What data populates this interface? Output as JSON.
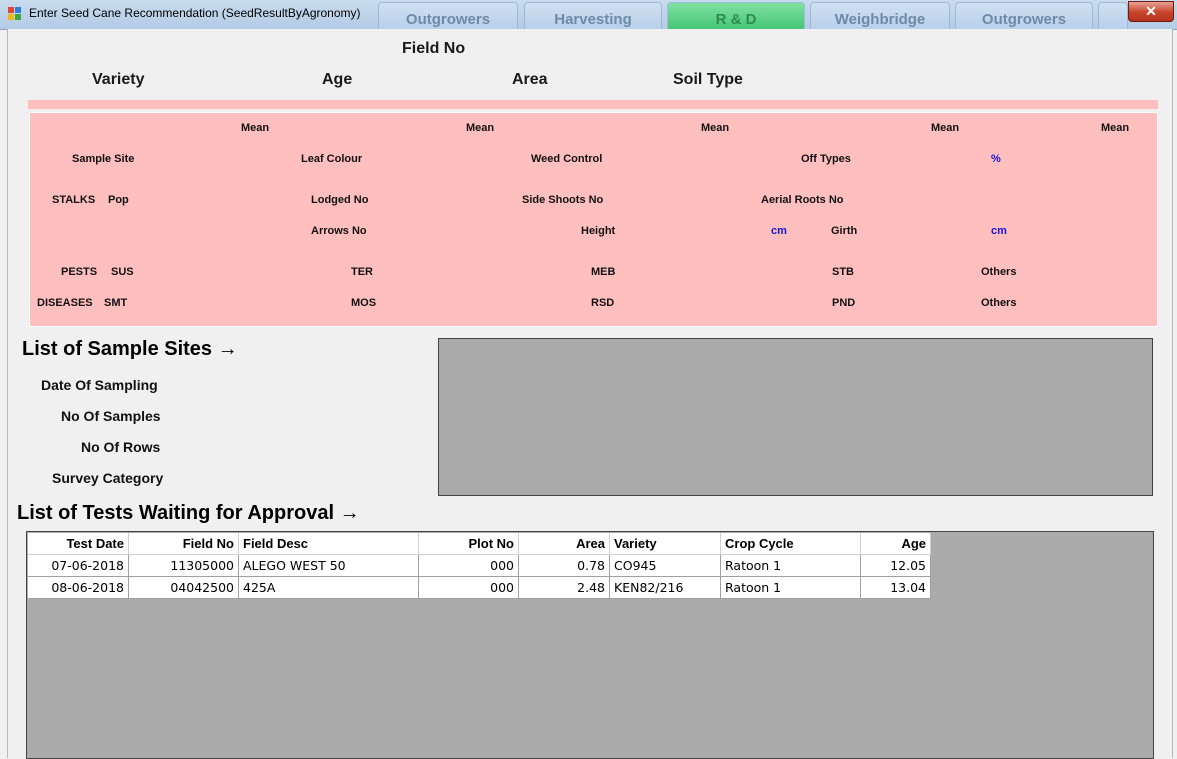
{
  "window": {
    "title": "Enter Seed Cane Recommendation (SeedResultByAgronomy)",
    "background_tabs": [
      "Outgrowers",
      "Harvesting",
      "R & D",
      "Weighbridge",
      "Outgrowers"
    ],
    "close_label": "✕"
  },
  "header": {
    "field_no": "Field No",
    "variety": "Variety",
    "age": "Age",
    "area": "Area",
    "soil_type": "Soil Type"
  },
  "panel": {
    "mean": "Mean",
    "sample_site": "Sample Site",
    "leaf_colour": "Leaf Colour",
    "weed_control": "Weed Control",
    "off_types": "Off Types",
    "percent": "%",
    "stalks": "STALKS",
    "pop": "Pop",
    "lodged_no": "Lodged No",
    "side_shoots_no": "Side Shoots No",
    "aerial_roots_no": "Aerial Roots No",
    "arrows_no": "Arrows No",
    "height": "Height",
    "cm": "cm",
    "girth": "Girth",
    "pests": "PESTS",
    "sus": "SUS",
    "ter": "TER",
    "meb": "MEB",
    "stb": "STB",
    "others": "Others",
    "diseases": "DISEASES",
    "smt": "SMT",
    "mos": "MOS",
    "rsd": "RSD",
    "pnd": "PND"
  },
  "sample_sites": {
    "title": "List of Sample Sites →",
    "date_of_sampling": "Date Of Sampling",
    "no_of_samples": "No Of Samples",
    "no_of_rows": "No Of Rows",
    "survey_category": "Survey Category"
  },
  "approval": {
    "title": "List of Tests Waiting for Approval →",
    "columns": [
      "Test Date",
      "Field No",
      "Field Desc",
      "Plot No",
      "Area",
      "Variety",
      "Crop Cycle",
      "Age"
    ],
    "rows": [
      [
        "07-06-2018",
        "11305000",
        "ALEGO WEST 50",
        "000",
        "0.78",
        "CO945",
        "Ratoon 1",
        "12.05"
      ],
      [
        "08-06-2018",
        "04042500",
        "425A",
        "000",
        "2.48",
        "KEN82/216",
        "Ratoon 1",
        "13.04"
      ]
    ]
  }
}
